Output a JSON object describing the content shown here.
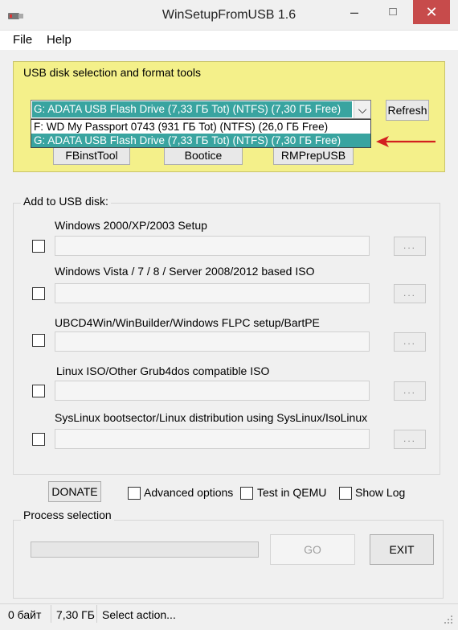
{
  "window": {
    "title": "WinSetupFromUSB 1.6",
    "controls": {
      "minimize": "–",
      "maximize": "□",
      "close": "✕"
    }
  },
  "menu": [
    "File",
    "Help"
  ],
  "usb_group": {
    "legend": "USB disk selection and format tools",
    "selected_disk": "G: ADATA USB Flash Drive (7,33 ГБ Tot) (NTFS) (7,30 ГБ Free)",
    "dropdown_options": [
      "F: WD My Passport 0743 (931 ГБ Tot) (NTFS) (26,0 ГБ Free)",
      "G: ADATA USB Flash Drive (7,33 ГБ Tot) (NTFS) (7,30 ГБ Free)"
    ],
    "refresh_label": "Refresh",
    "tool_buttons": [
      "FBinstTool",
      "Bootice",
      "RMPrepUSB"
    ],
    "highlight_color": "#f4f08a",
    "selection_color": "#39a4a0",
    "arrow_color": "#d21f1f"
  },
  "add_group": {
    "legend": "Add to USB disk:",
    "sections": [
      {
        "label": "Windows 2000/XP/2003 Setup",
        "browse": "..."
      },
      {
        "label": "Windows Vista / 7 / 8 / Server 2008/2012 based ISO",
        "browse": "..."
      },
      {
        "label": "UBCD4Win/WinBuilder/Windows FLPC setup/BartPE",
        "browse": "..."
      },
      {
        "label": "Linux ISO/Other Grub4dos compatible ISO",
        "browse": "..."
      },
      {
        "label": "SysLinux bootsector/Linux distribution using SysLinux/IsoLinux",
        "browse": "..."
      }
    ]
  },
  "options": {
    "donate_label": "DONATE",
    "advanced": "Advanced options",
    "qemu": "Test in QEMU",
    "showlog": "Show Log"
  },
  "process": {
    "legend": "Process selection",
    "go_label": "GO",
    "exit_label": "EXIT"
  },
  "status": {
    "size1": "0 байт",
    "size2": "7,30 ГБ",
    "message": "Select action..."
  }
}
